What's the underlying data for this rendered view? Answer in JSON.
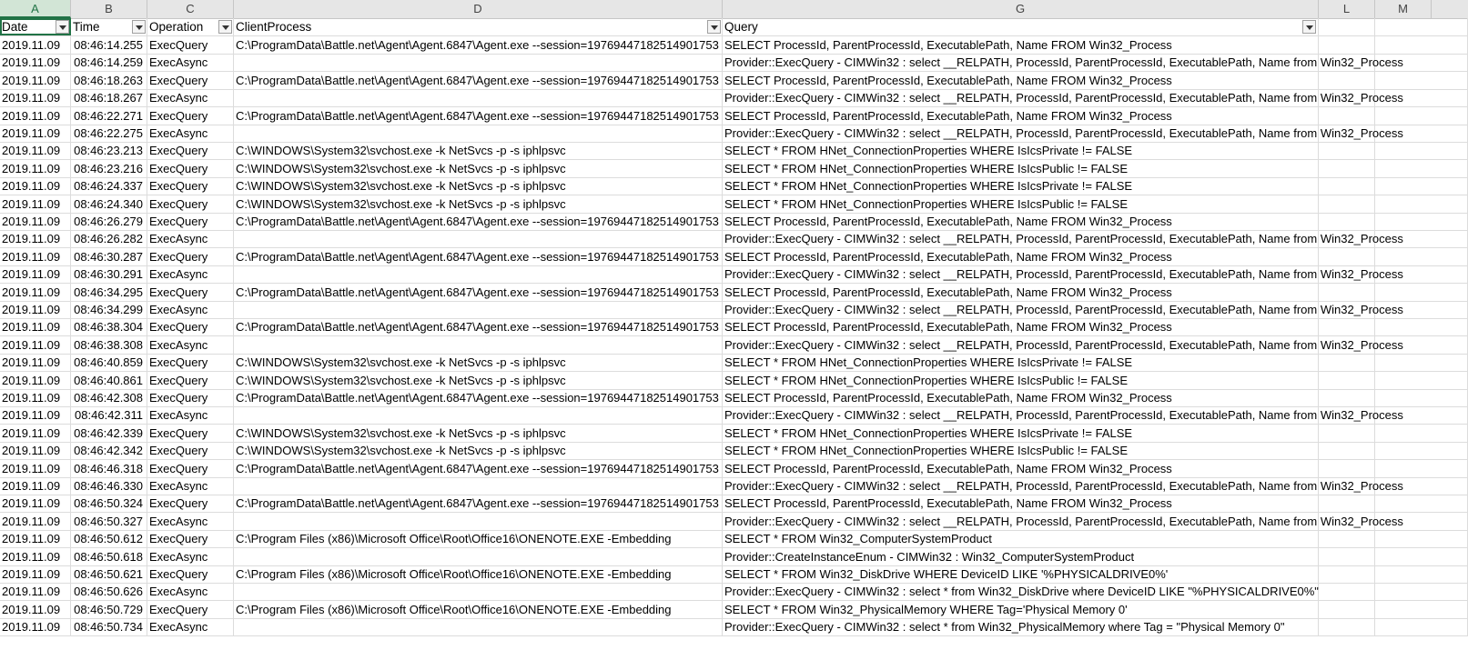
{
  "columns": [
    "A",
    "B",
    "C",
    "D",
    "G",
    "L",
    "M"
  ],
  "header": {
    "date": "Date",
    "time": "Time",
    "operation": "Operation",
    "client": "ClientProcess",
    "query": "Query"
  },
  "rows": [
    {
      "date": "2019.11.09",
      "time": "08:46:14.255",
      "operation": "ExecQuery",
      "client": "C:\\ProgramData\\Battle.net\\Agent\\Agent.6847\\Agent.exe --session=19769447182514901753",
      "query": "SELECT ProcessId, ParentProcessId, ExecutablePath, Name FROM Win32_Process"
    },
    {
      "date": "2019.11.09",
      "time": "08:46:14.259",
      "operation": "ExecAsync",
      "client": "",
      "query": "Provider::ExecQuery - CIMWin32 : select __RELPATH, ProcessId, ParentProcessId, ExecutablePath, Name from Win32_Process"
    },
    {
      "date": "2019.11.09",
      "time": "08:46:18.263",
      "operation": "ExecQuery",
      "client": "C:\\ProgramData\\Battle.net\\Agent\\Agent.6847\\Agent.exe --session=19769447182514901753",
      "query": "SELECT ProcessId, ParentProcessId, ExecutablePath, Name FROM Win32_Process"
    },
    {
      "date": "2019.11.09",
      "time": "08:46:18.267",
      "operation": "ExecAsync",
      "client": "",
      "query": "Provider::ExecQuery - CIMWin32 : select __RELPATH, ProcessId, ParentProcessId, ExecutablePath, Name from Win32_Process"
    },
    {
      "date": "2019.11.09",
      "time": "08:46:22.271",
      "operation": "ExecQuery",
      "client": "C:\\ProgramData\\Battle.net\\Agent\\Agent.6847\\Agent.exe --session=19769447182514901753",
      "query": "SELECT ProcessId, ParentProcessId, ExecutablePath, Name FROM Win32_Process"
    },
    {
      "date": "2019.11.09",
      "time": "08:46:22.275",
      "operation": "ExecAsync",
      "client": "",
      "query": "Provider::ExecQuery - CIMWin32 : select __RELPATH, ProcessId, ParentProcessId, ExecutablePath, Name from Win32_Process"
    },
    {
      "date": "2019.11.09",
      "time": "08:46:23.213",
      "operation": "ExecQuery",
      "client": "C:\\WINDOWS\\System32\\svchost.exe -k NetSvcs -p -s iphlpsvc",
      "query": "SELECT * FROM HNet_ConnectionProperties WHERE IsIcsPrivate != FALSE"
    },
    {
      "date": "2019.11.09",
      "time": "08:46:23.216",
      "operation": "ExecQuery",
      "client": "C:\\WINDOWS\\System32\\svchost.exe -k NetSvcs -p -s iphlpsvc",
      "query": "SELECT * FROM HNet_ConnectionProperties WHERE IsIcsPublic != FALSE"
    },
    {
      "date": "2019.11.09",
      "time": "08:46:24.337",
      "operation": "ExecQuery",
      "client": "C:\\WINDOWS\\System32\\svchost.exe -k NetSvcs -p -s iphlpsvc",
      "query": "SELECT * FROM HNet_ConnectionProperties WHERE IsIcsPrivate != FALSE"
    },
    {
      "date": "2019.11.09",
      "time": "08:46:24.340",
      "operation": "ExecQuery",
      "client": "C:\\WINDOWS\\System32\\svchost.exe -k NetSvcs -p -s iphlpsvc",
      "query": "SELECT * FROM HNet_ConnectionProperties WHERE IsIcsPublic != FALSE"
    },
    {
      "date": "2019.11.09",
      "time": "08:46:26.279",
      "operation": "ExecQuery",
      "client": "C:\\ProgramData\\Battle.net\\Agent\\Agent.6847\\Agent.exe --session=19769447182514901753",
      "query": "SELECT ProcessId, ParentProcessId, ExecutablePath, Name FROM Win32_Process"
    },
    {
      "date": "2019.11.09",
      "time": "08:46:26.282",
      "operation": "ExecAsync",
      "client": "",
      "query": "Provider::ExecQuery - CIMWin32 : select __RELPATH, ProcessId, ParentProcessId, ExecutablePath, Name from Win32_Process"
    },
    {
      "date": "2019.11.09",
      "time": "08:46:30.287",
      "operation": "ExecQuery",
      "client": "C:\\ProgramData\\Battle.net\\Agent\\Agent.6847\\Agent.exe --session=19769447182514901753",
      "query": "SELECT ProcessId, ParentProcessId, ExecutablePath, Name FROM Win32_Process"
    },
    {
      "date": "2019.11.09",
      "time": "08:46:30.291",
      "operation": "ExecAsync",
      "client": "",
      "query": "Provider::ExecQuery - CIMWin32 : select __RELPATH, ProcessId, ParentProcessId, ExecutablePath, Name from Win32_Process"
    },
    {
      "date": "2019.11.09",
      "time": "08:46:34.295",
      "operation": "ExecQuery",
      "client": "C:\\ProgramData\\Battle.net\\Agent\\Agent.6847\\Agent.exe --session=19769447182514901753",
      "query": "SELECT ProcessId, ParentProcessId, ExecutablePath, Name FROM Win32_Process"
    },
    {
      "date": "2019.11.09",
      "time": "08:46:34.299",
      "operation": "ExecAsync",
      "client": "",
      "query": "Provider::ExecQuery - CIMWin32 : select __RELPATH, ProcessId, ParentProcessId, ExecutablePath, Name from Win32_Process"
    },
    {
      "date": "2019.11.09",
      "time": "08:46:38.304",
      "operation": "ExecQuery",
      "client": "C:\\ProgramData\\Battle.net\\Agent\\Agent.6847\\Agent.exe --session=19769447182514901753",
      "query": "SELECT ProcessId, ParentProcessId, ExecutablePath, Name FROM Win32_Process"
    },
    {
      "date": "2019.11.09",
      "time": "08:46:38.308",
      "operation": "ExecAsync",
      "client": "",
      "query": "Provider::ExecQuery - CIMWin32 : select __RELPATH, ProcessId, ParentProcessId, ExecutablePath, Name from Win32_Process"
    },
    {
      "date": "2019.11.09",
      "time": "08:46:40.859",
      "operation": "ExecQuery",
      "client": "C:\\WINDOWS\\System32\\svchost.exe -k NetSvcs -p -s iphlpsvc",
      "query": "SELECT * FROM HNet_ConnectionProperties WHERE IsIcsPrivate != FALSE"
    },
    {
      "date": "2019.11.09",
      "time": "08:46:40.861",
      "operation": "ExecQuery",
      "client": "C:\\WINDOWS\\System32\\svchost.exe -k NetSvcs -p -s iphlpsvc",
      "query": "SELECT * FROM HNet_ConnectionProperties WHERE IsIcsPublic != FALSE"
    },
    {
      "date": "2019.11.09",
      "time": "08:46:42.308",
      "operation": "ExecQuery",
      "client": "C:\\ProgramData\\Battle.net\\Agent\\Agent.6847\\Agent.exe --session=19769447182514901753",
      "query": "SELECT ProcessId, ParentProcessId, ExecutablePath, Name FROM Win32_Process"
    },
    {
      "date": "2019.11.09",
      "time": "08:46:42.311",
      "operation": "ExecAsync",
      "client": "",
      "query": "Provider::ExecQuery - CIMWin32 : select __RELPATH, ProcessId, ParentProcessId, ExecutablePath, Name from Win32_Process"
    },
    {
      "date": "2019.11.09",
      "time": "08:46:42.339",
      "operation": "ExecQuery",
      "client": "C:\\WINDOWS\\System32\\svchost.exe -k NetSvcs -p -s iphlpsvc",
      "query": "SELECT * FROM HNet_ConnectionProperties WHERE IsIcsPrivate != FALSE"
    },
    {
      "date": "2019.11.09",
      "time": "08:46:42.342",
      "operation": "ExecQuery",
      "client": "C:\\WINDOWS\\System32\\svchost.exe -k NetSvcs -p -s iphlpsvc",
      "query": "SELECT * FROM HNet_ConnectionProperties WHERE IsIcsPublic != FALSE"
    },
    {
      "date": "2019.11.09",
      "time": "08:46:46.318",
      "operation": "ExecQuery",
      "client": "C:\\ProgramData\\Battle.net\\Agent\\Agent.6847\\Agent.exe --session=19769447182514901753",
      "query": "SELECT ProcessId, ParentProcessId, ExecutablePath, Name FROM Win32_Process"
    },
    {
      "date": "2019.11.09",
      "time": "08:46:46.330",
      "operation": "ExecAsync",
      "client": "",
      "query": "Provider::ExecQuery - CIMWin32 : select __RELPATH, ProcessId, ParentProcessId, ExecutablePath, Name from Win32_Process"
    },
    {
      "date": "2019.11.09",
      "time": "08:46:50.324",
      "operation": "ExecQuery",
      "client": "C:\\ProgramData\\Battle.net\\Agent\\Agent.6847\\Agent.exe --session=19769447182514901753",
      "query": "SELECT ProcessId, ParentProcessId, ExecutablePath, Name FROM Win32_Process"
    },
    {
      "date": "2019.11.09",
      "time": "08:46:50.327",
      "operation": "ExecAsync",
      "client": "",
      "query": "Provider::ExecQuery - CIMWin32 : select __RELPATH, ProcessId, ParentProcessId, ExecutablePath, Name from Win32_Process"
    },
    {
      "date": "2019.11.09",
      "time": "08:46:50.612",
      "operation": "ExecQuery",
      "client": "C:\\Program Files (x86)\\Microsoft Office\\Root\\Office16\\ONENOTE.EXE -Embedding",
      "query": "SELECT * FROM Win32_ComputerSystemProduct"
    },
    {
      "date": "2019.11.09",
      "time": "08:46:50.618",
      "operation": "ExecAsync",
      "client": "",
      "query": "Provider::CreateInstanceEnum - CIMWin32 : Win32_ComputerSystemProduct"
    },
    {
      "date": "2019.11.09",
      "time": "08:46:50.621",
      "operation": "ExecQuery",
      "client": "C:\\Program Files (x86)\\Microsoft Office\\Root\\Office16\\ONENOTE.EXE -Embedding",
      "query": "SELECT * FROM Win32_DiskDrive WHERE DeviceID LIKE '%PHYSICALDRIVE0%'"
    },
    {
      "date": "2019.11.09",
      "time": "08:46:50.626",
      "operation": "ExecAsync",
      "client": "",
      "query": "Provider::ExecQuery - CIMWin32 : select * from Win32_DiskDrive where DeviceID LIKE \"%PHYSICALDRIVE0%\""
    },
    {
      "date": "2019.11.09",
      "time": "08:46:50.729",
      "operation": "ExecQuery",
      "client": "C:\\Program Files (x86)\\Microsoft Office\\Root\\Office16\\ONENOTE.EXE -Embedding",
      "query": "SELECT * FROM Win32_PhysicalMemory WHERE Tag='Physical Memory 0'"
    },
    {
      "date": "2019.11.09",
      "time": "08:46:50.734",
      "operation": "ExecAsync",
      "client": "",
      "query": "Provider::ExecQuery - CIMWin32 : select * from Win32_PhysicalMemory where Tag = \"Physical Memory 0\""
    }
  ],
  "colors": {
    "header_bg": "#e6e6e6",
    "active_col": "#217346",
    "grid": "#dcdcdc"
  }
}
